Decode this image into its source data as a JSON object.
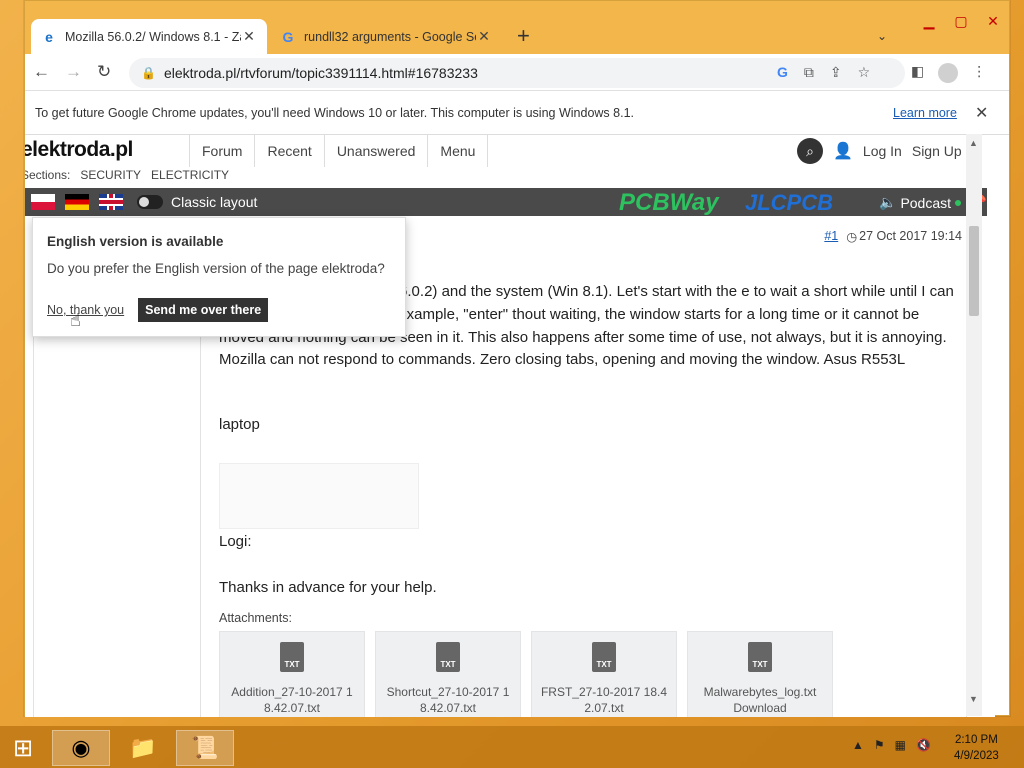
{
  "window": {
    "tabs": [
      {
        "title": "Mozilla 56.0.2/ Windows 8.1 - Za",
        "favicon": "ie-e-icon",
        "active": true
      },
      {
        "title": "rundll32 arguments - Google Se",
        "favicon": "google-g-icon",
        "active": false
      }
    ],
    "new_tab": "+",
    "controls": {
      "minimize": "▬",
      "maximize": "▢",
      "close": "✕"
    }
  },
  "toolbar": {
    "url": "elektroda.pl/rtvforum/topic3391114.html#16783233"
  },
  "infobar": {
    "message": "To get future Google Chrome updates, you'll need Windows 10 or later. This computer is using Windows 8.1.",
    "learn_more": "Learn more"
  },
  "site": {
    "logo": "elektroda.pl",
    "nav": [
      "Forum",
      "Recent",
      "Unanswered",
      "Menu"
    ],
    "login": "Log In",
    "signup": "Sign Up",
    "sections_label": "Sections:",
    "sections": [
      "SECURITY",
      "ELECTRICITY"
    ],
    "classic_layout": "Classic layout",
    "sponsors": [
      "PCBWay",
      "JLCPCB"
    ],
    "podcast": "Podcast"
  },
  "post": {
    "number": "#1",
    "date": "27 Oct 2017 19:14",
    "body": "time with Mozilla (version 56.0.2) and the system (Win 8.1). Let's start with the e to wait a short while until I can launch any program or, for example, \"enter\" thout waiting, the window starts for a long time or it cannot be moved and nothing can be seen in it. This also happens after some time of use, not always, but it is annoying. Mozilla can not respond to commands. Zero closing tabs, opening and moving the window. Asus R553L",
    "laptop": "laptop",
    "logi": "Logi:",
    "thanks": "Thanks in advance for your help.",
    "attachments_label": "Attachments:",
    "attachments": [
      {
        "name": "Addition_27-10-2017 1 8.42.07.txt"
      },
      {
        "name": "Shortcut_27-10-2017 1 8.42.07.txt"
      },
      {
        "name": "FRST_27-10-2017 18.4 2.07.txt"
      },
      {
        "name": "Malwarebytes_log.txt Download"
      }
    ]
  },
  "popup": {
    "title": "English version is available",
    "question": "Do you prefer the English version of the page elektroda?",
    "no_thanks": "No, thank you",
    "send": "Send me over there"
  },
  "taskbar": {
    "time": "2:10 PM",
    "date": "4/9/2023"
  }
}
